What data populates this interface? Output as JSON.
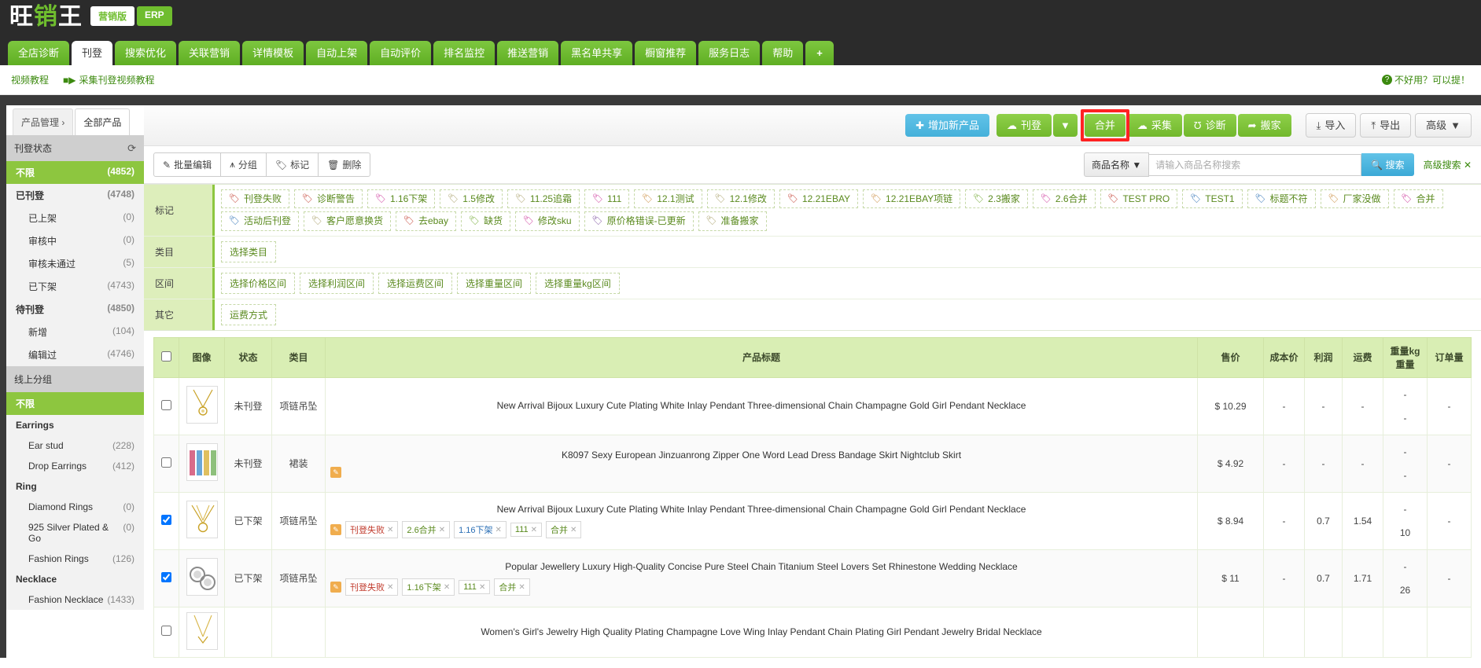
{
  "brand": {
    "name_part1": "旺",
    "name_part2": "销",
    "name_part3": "王",
    "badge_marketing": "营销版",
    "badge_erp": "ERP"
  },
  "nav": {
    "tabs": [
      {
        "label": "全店诊断",
        "active": false
      },
      {
        "label": "刊登",
        "active": true
      },
      {
        "label": "搜索优化",
        "active": false
      },
      {
        "label": "关联营销",
        "active": false
      },
      {
        "label": "详情模板",
        "active": false
      },
      {
        "label": "自动上架",
        "active": false
      },
      {
        "label": "自动评价",
        "active": false
      },
      {
        "label": "排名监控",
        "active": false
      },
      {
        "label": "推送营销",
        "active": false
      },
      {
        "label": "黑名单共享",
        "active": false
      },
      {
        "label": "橱窗推荐",
        "active": false
      },
      {
        "label": "服务日志",
        "active": false
      },
      {
        "label": "帮助",
        "active": false
      }
    ],
    "add_tab": "+"
  },
  "subnav": {
    "video_tutorial": "视频教程",
    "collect_tutorial": "采集刊登视频教程",
    "feedback": "不好用？可以提！"
  },
  "producttabs": {
    "breadcrumb": "产品管理",
    "arrow": "›",
    "all_products": "全部产品"
  },
  "sidebar": {
    "status_header": "刊登状态",
    "refresh_icon": "refresh-icon",
    "status_items": [
      {
        "label": "不限",
        "count": "(4852)",
        "level": 1,
        "active": true
      },
      {
        "label": "已刊登",
        "count": "(4748)",
        "level": 1,
        "active": false
      },
      {
        "label": "已上架",
        "count": "(0)",
        "level": 2,
        "active": false
      },
      {
        "label": "审核中",
        "count": "(0)",
        "level": 2,
        "active": false
      },
      {
        "label": "审核未通过",
        "count": "(5)",
        "level": 2,
        "active": false
      },
      {
        "label": "已下架",
        "count": "(4743)",
        "level": 2,
        "active": false
      },
      {
        "label": "待刊登",
        "count": "(4850)",
        "level": 1,
        "active": false
      },
      {
        "label": "新增",
        "count": "(104)",
        "level": 2,
        "active": false
      },
      {
        "label": "编辑过",
        "count": "(4746)",
        "level": 2,
        "active": false
      }
    ],
    "group_header": "线上分组",
    "group_items": [
      {
        "label": "不限",
        "count": "",
        "level": 1,
        "active": true
      },
      {
        "label": "Earrings",
        "count": "",
        "level": 0,
        "active": false
      },
      {
        "label": "Ear stud",
        "count": "(228)",
        "level": 2,
        "active": false
      },
      {
        "label": "Drop Earrings",
        "count": "(412)",
        "level": 2,
        "active": false
      },
      {
        "label": "Ring",
        "count": "",
        "level": 0,
        "active": false
      },
      {
        "label": "Diamond Rings",
        "count": "(0)",
        "level": 2,
        "active": false
      },
      {
        "label": "925 Silver Plated & Go",
        "count": "(0)",
        "level": 2,
        "active": false
      },
      {
        "label": "Fashion Rings",
        "count": "(126)",
        "level": 2,
        "active": false
      },
      {
        "label": "Necklace",
        "count": "",
        "level": 0,
        "active": false
      },
      {
        "label": "Fashion Necklace",
        "count": "(1433)",
        "level": 2,
        "active": false
      }
    ]
  },
  "toolbar": {
    "add_product": "增加新产品",
    "publish": "刊登",
    "publish_caret": "▼",
    "merge": "合并",
    "collect": "采集",
    "diagnose": "诊断",
    "move": "搬家",
    "import": "导入",
    "export": "导出",
    "advanced": "高级",
    "advanced_caret": "▼",
    "highlight_color": "#ff2222"
  },
  "actions": {
    "batch_edit": "批量编辑",
    "group": "分组",
    "mark": "标记",
    "delete": "删除"
  },
  "search": {
    "field_label": "商品名称",
    "field_caret": "▼",
    "placeholder": "请输入商品名称搜索",
    "value": "",
    "button": "搜索",
    "advanced": "高级搜索"
  },
  "filters": {
    "mark_label": "标记",
    "mark_tags_row1": [
      {
        "label": "刊登失败",
        "color": "#c0392b"
      },
      {
        "label": "诊断警告",
        "color": "#c0392b"
      },
      {
        "label": "1.16下架",
        "color": "#cc3399"
      },
      {
        "label": "1.5修改",
        "color": "#a9a06a"
      },
      {
        "label": "11.25追霜",
        "color": "#a9a06a"
      },
      {
        "label": "111",
        "color": "#cc3399"
      },
      {
        "label": "12.1测试",
        "color": "#c98a3a"
      },
      {
        "label": "12.1修改",
        "color": "#a9a06a"
      },
      {
        "label": "12.21EBAY",
        "color": "#c0392b"
      },
      {
        "label": "12.21EBAY项链",
        "color": "#c98a3a"
      },
      {
        "label": "2.3搬家",
        "color": "#6fa82e"
      },
      {
        "label": "2.6合并",
        "color": "#cc3399"
      },
      {
        "label": "TEST PRO",
        "color": "#c0392b"
      },
      {
        "label": "TEST1",
        "color": "#2b6fb5"
      },
      {
        "label": "标题不符",
        "color": "#2b6fb5"
      },
      {
        "label": "厂家没做",
        "color": "#c98a3a"
      }
    ],
    "mark_tags_row2": [
      {
        "label": "合并",
        "color": "#cc3399"
      },
      {
        "label": "活动后刊登",
        "color": "#2b6fb5"
      },
      {
        "label": "客户愿意换货",
        "color": "#a9a06a"
      },
      {
        "label": "去ebay",
        "color": "#c0392b"
      },
      {
        "label": "缺货",
        "color": "#6fa82e"
      },
      {
        "label": "修改sku",
        "color": "#cc3399"
      },
      {
        "label": "原价格错误-已更新",
        "color": "#7a4b9e"
      },
      {
        "label": "准备搬家",
        "color": "#a9a06a"
      }
    ],
    "category_label": "类目",
    "category_chips": [
      "选择类目"
    ],
    "range_label": "区间",
    "range_chips": [
      "选择价格区间",
      "选择利润区间",
      "选择运费区间",
      "选择重量区间",
      "选择重量kg区间"
    ],
    "other_label": "其它",
    "other_chips": [
      "运费方式"
    ]
  },
  "table": {
    "headers": {
      "checkbox": "",
      "image": "图像",
      "status": "状态",
      "category": "类目",
      "title": "产品标题",
      "price": "售价",
      "cost": "成本价",
      "profit": "利润",
      "shipping": "运费",
      "weight": "重量kg 重量",
      "weight_l1": "重量kg",
      "weight_l2": "重量",
      "orders": "订单量"
    },
    "rows": [
      {
        "checked": false,
        "status": "未刊登",
        "category": "项链吊坠",
        "title": "New Arrival Bijoux Luxury Cute Plating White Inlay Pendant Three-dimensional Chain Champagne Gold Girl Pendant Necklace",
        "has_edit_icon": false,
        "tags": [],
        "price": "$ 10.29",
        "cost": "-",
        "profit": "-",
        "shipping": "-",
        "weight_kg": "-",
        "weight": "-",
        "orders": "-"
      },
      {
        "checked": false,
        "status": "未刊登",
        "category": "裙装",
        "title": "K8097 Sexy European Jinzuanrong Zipper One Word Lead Dress Bandage Skirt Nightclub Skirt",
        "has_edit_icon": true,
        "tags": [],
        "price": "$ 4.92",
        "cost": "-",
        "profit": "-",
        "shipping": "-",
        "weight_kg": "-",
        "weight": "-",
        "orders": "-"
      },
      {
        "checked": true,
        "status": "已下架",
        "category": "项链吊坠",
        "title": "New Arrival Bijoux Luxury Cute Plating White Inlay Pendant Three-dimensional Chain Champagne Gold Girl Pendant Necklace",
        "has_edit_icon": true,
        "tags": [
          {
            "label": "刊登失败",
            "color": "#c0392b"
          },
          {
            "label": "2.6合并",
            "color": "#5a8a1e"
          },
          {
            "label": "1.16下架",
            "color": "#2b6fb5"
          },
          {
            "label": "111",
            "color": "#5a8a1e"
          },
          {
            "label": "合并",
            "color": "#5a8a1e"
          }
        ],
        "price": "$ 8.94",
        "cost": "-",
        "profit": "0.7",
        "shipping": "1.54",
        "weight_kg": "-",
        "weight": "10",
        "orders": "-"
      },
      {
        "checked": true,
        "status": "已下架",
        "category": "项链吊坠",
        "title": "Popular Jewellery Luxury High-Quality Concise Pure Steel Chain Titanium Steel Lovers Set Rhinestone Wedding Necklace",
        "has_edit_icon": true,
        "tags": [
          {
            "label": "刊登失败",
            "color": "#c0392b"
          },
          {
            "label": "1.16下架",
            "color": "#5a8a1e"
          },
          {
            "label": "111",
            "color": "#5a8a1e"
          },
          {
            "label": "合并",
            "color": "#5a8a1e"
          }
        ],
        "price": "$ 11",
        "cost": "-",
        "profit": "0.7",
        "shipping": "1.71",
        "weight_kg": "-",
        "weight": "26",
        "orders": "-"
      },
      {
        "checked": false,
        "status": "",
        "category": "",
        "title": "Women's Girl's Jewelry High Quality Plating Champagne Love Wing Inlay Pendant Chain Plating Girl Pendant Jewelry Bridal Necklace",
        "has_edit_icon": false,
        "tags": [],
        "price": "",
        "cost": "",
        "profit": "",
        "shipping": "",
        "weight_kg": "",
        "weight": "",
        "orders": ""
      }
    ]
  }
}
